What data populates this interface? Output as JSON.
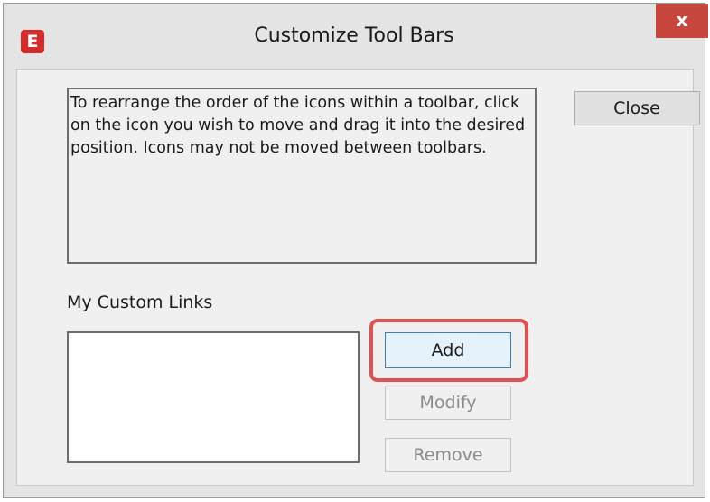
{
  "window": {
    "title": "Customize Tool Bars",
    "app_icon_letter": "E",
    "close_glyph": "x"
  },
  "instructions": {
    "text": "To rearrange the order of the icons within a toolbar, click on the icon you wish to move and drag it into the desired position. Icons may not be moved between toolbars."
  },
  "buttons": {
    "close_label": "Close",
    "add_label": "Add",
    "modify_label": "Modify",
    "remove_label": "Remove"
  },
  "custom_links": {
    "label": "My Custom Links",
    "items": []
  },
  "colors": {
    "accent_red": "#d52b2b",
    "highlight": "#e05252",
    "close_button": "#c7463e"
  },
  "icons": {
    "app": "e-app-icon",
    "close": "close-icon"
  }
}
